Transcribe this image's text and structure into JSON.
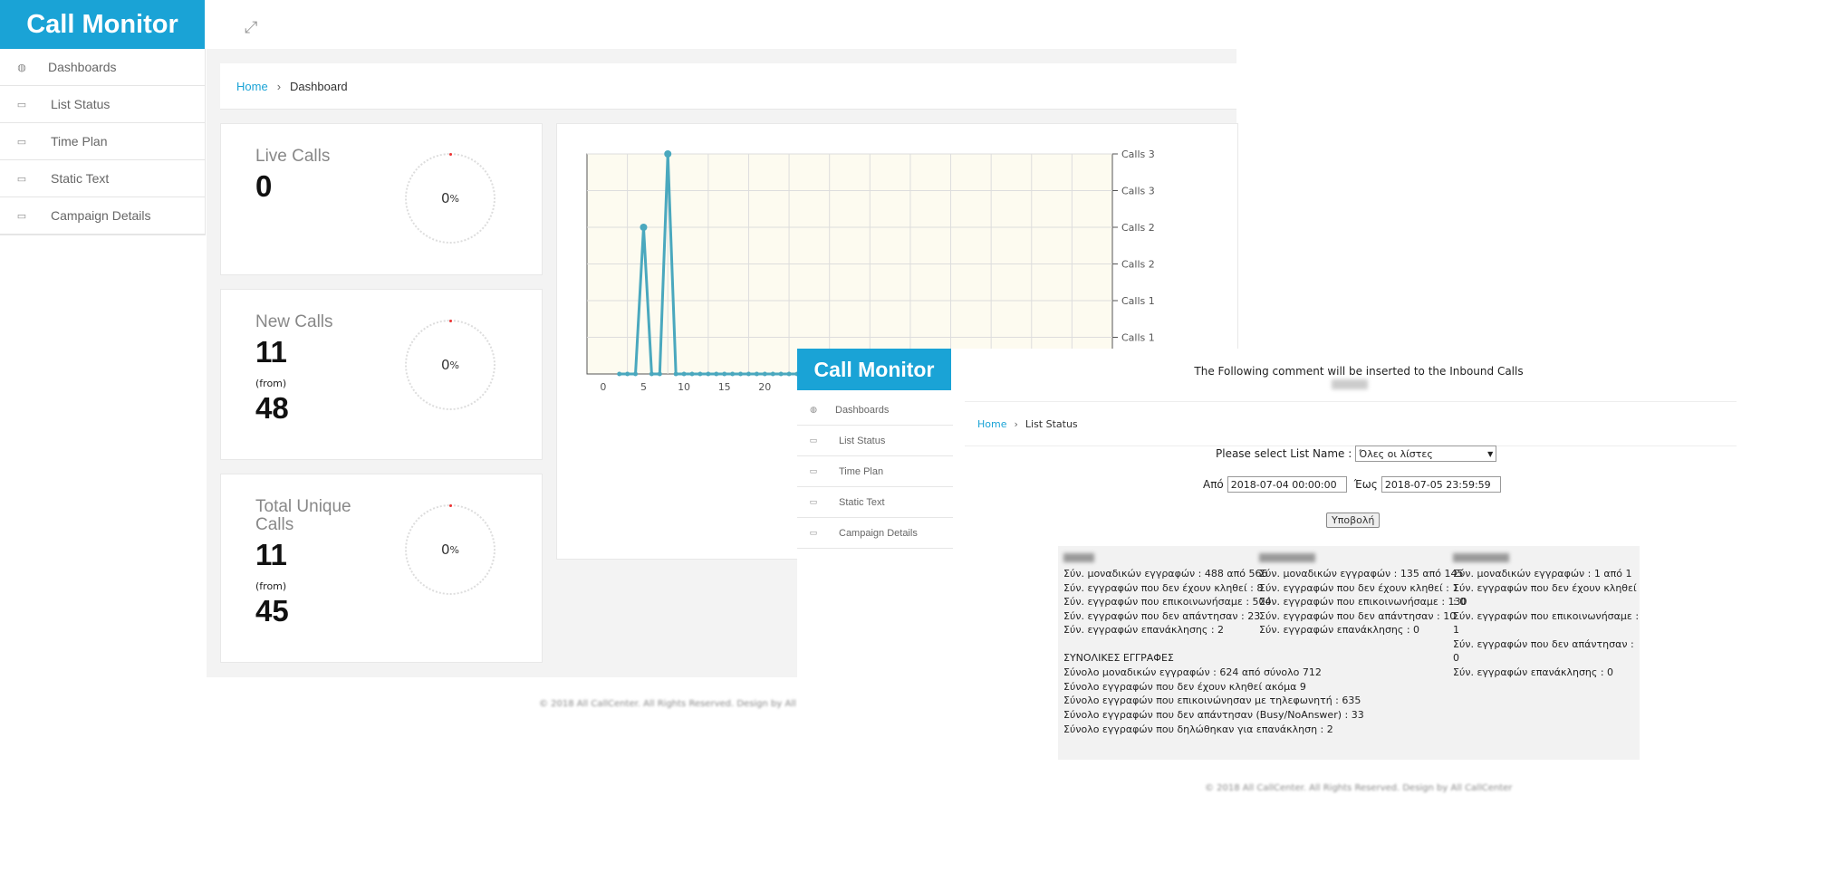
{
  "window_a": {
    "brand": "Call Monitor",
    "sidebar": [
      {
        "label": "Dashboards",
        "icon": "dashboard-icon"
      },
      {
        "label": "List Status",
        "icon": "inbox-icon"
      },
      {
        "label": "Time Plan",
        "icon": "inbox-icon"
      },
      {
        "label": "Static Text",
        "icon": "inbox-icon"
      },
      {
        "label": "Campaign Details",
        "icon": "inbox-icon"
      }
    ],
    "breadcrumb": {
      "home": "Home",
      "sep": "›",
      "current": "Dashboard"
    },
    "cards": [
      {
        "title": "Live Calls",
        "value": "0",
        "percent": "0",
        "unit": "%"
      },
      {
        "title": "New Calls",
        "value": "11",
        "from_label": "(from)",
        "from_value": "48",
        "percent": "0",
        "unit": "%"
      },
      {
        "title": "Total Unique Calls",
        "value": "11",
        "from_label": "(from)",
        "from_value": "45",
        "percent": "0",
        "unit": "%"
      }
    ],
    "footer": "© 2018 All CallCenter. All Rights Reserved. Design by All CallCenter"
  },
  "chart_data": {
    "type": "line",
    "x_ticks": [
      "0",
      "5",
      "10",
      "15",
      "20"
    ],
    "y_tick_labels": [
      "Calls 3",
      "Calls 3",
      "Calls 2",
      "Calls 2",
      "Calls 1",
      "Calls 1"
    ],
    "x": [
      2,
      3,
      4,
      5,
      6,
      7,
      8,
      9,
      10,
      11,
      12,
      13,
      14,
      15,
      16,
      17,
      18,
      19,
      20,
      21,
      22,
      23,
      24,
      25,
      26
    ],
    "y": [
      0,
      0,
      0,
      2,
      0,
      0,
      3,
      0,
      0,
      0,
      0,
      0,
      0,
      0,
      0,
      0,
      0,
      0,
      0,
      0,
      0,
      0,
      0,
      0,
      0
    ],
    "xlim": [
      -2,
      63
    ],
    "ylim": [
      0,
      3
    ],
    "color": "#4aa8be",
    "plot_bg": "#fdfbf0",
    "grid": true
  },
  "window_b": {
    "brand": "Call Monitor",
    "sidebar": [
      {
        "label": "Dashboards",
        "icon": "dashboard-icon"
      },
      {
        "label": "List Status",
        "icon": "inbox-icon"
      },
      {
        "label": "Time Plan",
        "icon": "inbox-icon"
      },
      {
        "label": "Static Text",
        "icon": "inbox-icon"
      },
      {
        "label": "Campaign Details",
        "icon": "inbox-icon"
      }
    ],
    "comment": "The Following comment will be inserted to the Inbound Calls",
    "breadcrumb": {
      "home": "Home",
      "sep": "›",
      "current": "List Status"
    },
    "form": {
      "list_label": "Please select List Name :",
      "list_value": "Όλες οι λίστες",
      "from_label": "Από",
      "from_value": "2018-07-04 00:00:00",
      "to_label": "Έως",
      "to_value": "2018-07-05 23:59:59",
      "submit": "Υποβολή"
    },
    "stats_columns": [
      [
        "Σύν. μοναδικών εγγραφών : 488 από 566",
        "Σύν. εγγραφών που δεν έχουν κληθεί : 8",
        "Σύν. εγγραφών που επικοινωνήσαμε : 504",
        "Σύν. εγγραφών που δεν απάντησαν : 23",
        "Σύν. εγγραφών επανάκλησης : 2"
      ],
      [
        "Σύν. μοναδικών εγγραφών : 135 από 145",
        "Σύν. εγγραφών που δεν έχουν κληθεί : 1",
        "Σύν. εγγραφών που επικοινωνήσαμε : 130",
        "Σύν. εγγραφών που δεν απάντησαν : 10",
        "Σύν. εγγραφών επανάκλησης : 0"
      ],
      [
        "Σύν. μοναδικών εγγραφών : 1 από 1",
        "Σύν. εγγραφών που δεν έχουν κληθεί : 0",
        "Σύν. εγγραφών που επικοινωνήσαμε : 1",
        "Σύν. εγγραφών που δεν απάντησαν : 0",
        "Σύν. εγγραφών επανάκλησης : 0"
      ]
    ],
    "totals_title": "ΣΥΝΟΛΙΚΕΣ ΕΓΓΡΑΦΕΣ",
    "totals": [
      "Σύνολο μοναδικών εγγραφών : 624 από σύνολο 712",
      "Σύνολο εγγραφών που δεν έχουν κληθεί ακόμα 9",
      "Σύνολο εγγραφών που επικοινώνησαν με τηλεφωνητή : 635",
      "Σύνολο εγγραφών που δεν απάντησαν (Busy/NoAnswer) : 33",
      "Σύνολο εγγραφών που δηλώθηκαν για επανάκληση : 2"
    ],
    "footer": "© 2018 All CallCenter. All Rights Reserved. Design by All CallCenter"
  }
}
